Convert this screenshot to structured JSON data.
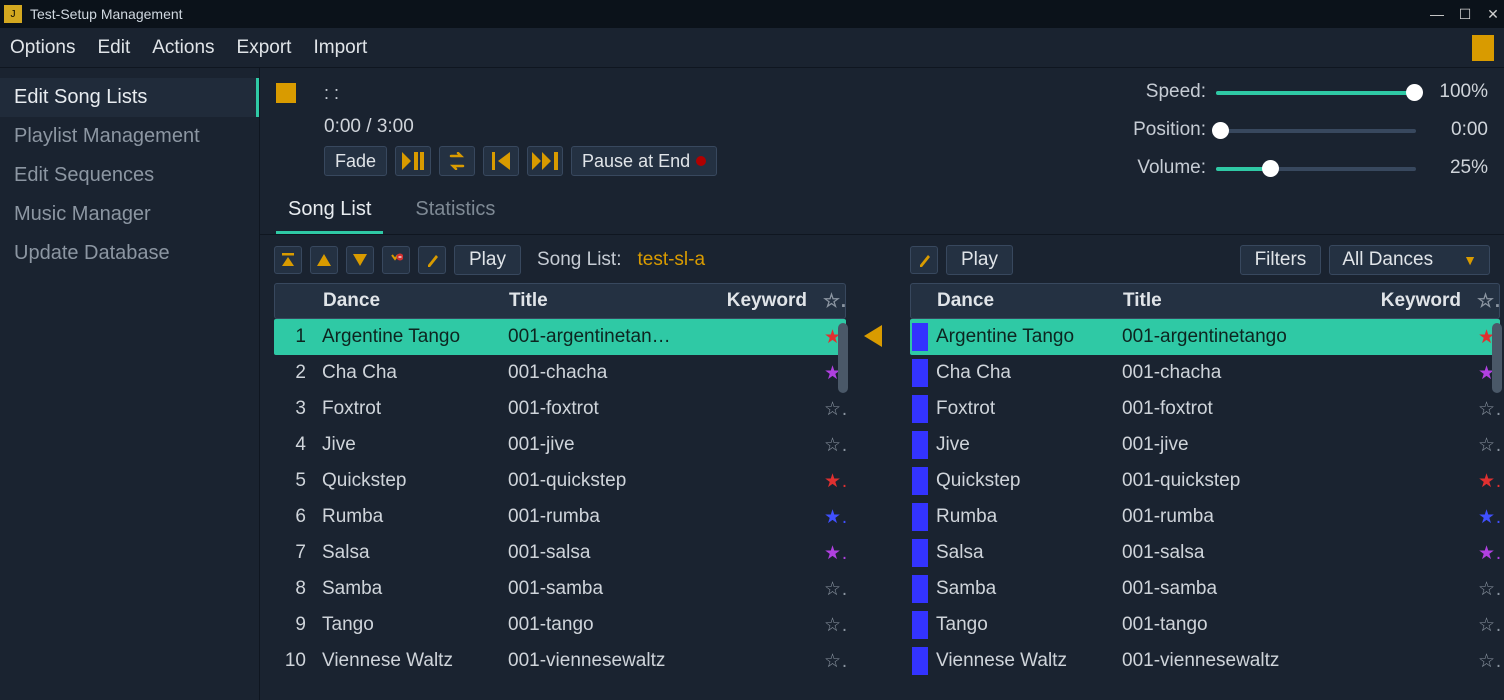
{
  "window_title": "Test-Setup Management",
  "menubar": [
    "Options",
    "Edit",
    "Actions",
    "Export",
    "Import"
  ],
  "sidebar": {
    "items": [
      {
        "label": "Edit Song Lists",
        "active": true
      },
      {
        "label": "Playlist Management",
        "active": false
      },
      {
        "label": "Edit Sequences",
        "active": false
      },
      {
        "label": "Music Manager",
        "active": false
      },
      {
        "label": "Update Database",
        "active": false
      }
    ]
  },
  "player": {
    "timeline": ":  :",
    "elapsed": "0:00 /   3:00",
    "fade_label": "Fade",
    "pause_at_end_label": "Pause at End",
    "sliders": {
      "speed": {
        "label": "Speed:",
        "value": "100%",
        "pct": 100
      },
      "position": {
        "label": "Position:",
        "value": "0:00",
        "pct": 0
      },
      "volume": {
        "label": "Volume:",
        "value": "25%",
        "pct": 25
      }
    }
  },
  "tabs": [
    {
      "label": "Song List",
      "active": true
    },
    {
      "label": "Statistics",
      "active": false
    }
  ],
  "left_toolbar": {
    "play_label": "Play",
    "songlist_label": "Song List:",
    "songlist_name": "test-sl-a"
  },
  "right_toolbar": {
    "play_label": "Play",
    "filters_label": "Filters",
    "dances_label": "All Dances"
  },
  "headers": {
    "dance": "Dance",
    "title": "Title",
    "keyword": "Keyword"
  },
  "left_rows": [
    {
      "n": "1",
      "dance": "Argentine Tango",
      "title": "001-argentinetan…",
      "star": "red",
      "sel": true
    },
    {
      "n": "2",
      "dance": "Cha Cha",
      "title": "001-chacha",
      "star": "purple"
    },
    {
      "n": "3",
      "dance": "Foxtrot",
      "title": "001-foxtrot",
      "star": "none"
    },
    {
      "n": "4",
      "dance": "Jive",
      "title": "001-jive",
      "star": "none"
    },
    {
      "n": "5",
      "dance": "Quickstep",
      "title": "001-quickstep",
      "star": "red"
    },
    {
      "n": "6",
      "dance": "Rumba",
      "title": "001-rumba",
      "star": "blue"
    },
    {
      "n": "7",
      "dance": "Salsa",
      "title": "001-salsa",
      "star": "purple"
    },
    {
      "n": "8",
      "dance": "Samba",
      "title": "001-samba",
      "star": "none"
    },
    {
      "n": "9",
      "dance": "Tango",
      "title": "001-tango",
      "star": "none"
    },
    {
      "n": "10",
      "dance": "Viennese Waltz",
      "title": "001-viennesewaltz",
      "star": "none"
    }
  ],
  "right_rows": [
    {
      "dance": "Argentine Tango",
      "title": "001-argentinetango",
      "star": "red",
      "sel": true
    },
    {
      "dance": "Cha Cha",
      "title": "001-chacha",
      "star": "purple"
    },
    {
      "dance": "Foxtrot",
      "title": "001-foxtrot",
      "star": "none"
    },
    {
      "dance": "Jive",
      "title": "001-jive",
      "star": "none"
    },
    {
      "dance": "Quickstep",
      "title": "001-quickstep",
      "star": "red"
    },
    {
      "dance": "Rumba",
      "title": "001-rumba",
      "star": "blue"
    },
    {
      "dance": "Salsa",
      "title": "001-salsa",
      "star": "purple"
    },
    {
      "dance": "Samba",
      "title": "001-samba",
      "star": "none"
    },
    {
      "dance": "Tango",
      "title": "001-tango",
      "star": "none"
    },
    {
      "dance": "Viennese Waltz",
      "title": "001-viennesewaltz",
      "star": "none"
    }
  ]
}
